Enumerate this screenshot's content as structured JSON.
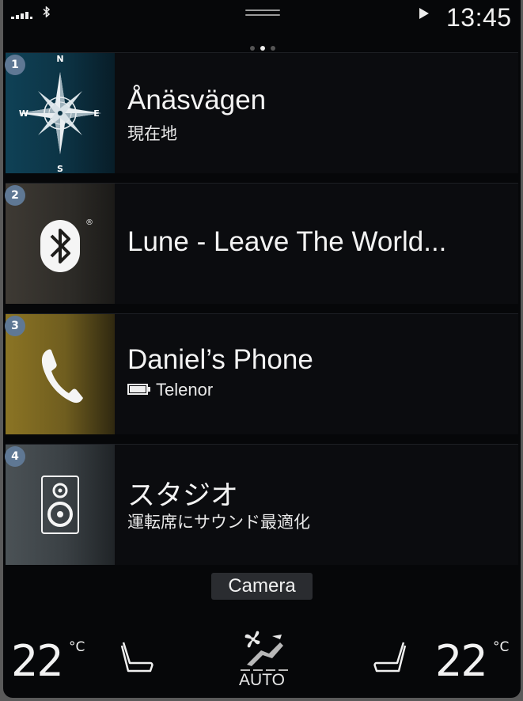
{
  "status": {
    "time": "13:45",
    "signal_icon": "signal-icon",
    "bluetooth_icon": "bluetooth-icon",
    "playing_icon": "play-icon"
  },
  "pager": {
    "pages": 3,
    "current": 2
  },
  "tiles": [
    {
      "number": "1",
      "title": "Ånäsvägen",
      "subtitle": "現在地",
      "icon": "compass-icon",
      "compass": {
        "n": "N",
        "e": "E",
        "s": "S",
        "w": "W"
      }
    },
    {
      "number": "2",
      "title": "Lune - Leave The World...",
      "icon": "bluetooth-icon",
      "registered": "®"
    },
    {
      "number": "3",
      "title": "Daniel’s Phone",
      "subtitle": "Telenor",
      "icon": "phone-icon",
      "battery_icon": "battery-icon"
    },
    {
      "number": "4",
      "title": "スタジオ",
      "subtitle": "運転席にサウンド最適化",
      "icon": "speaker-icon"
    }
  ],
  "camera_button": "Camera",
  "climate": {
    "left_temp": "22",
    "right_temp": "22",
    "unit": "°C",
    "auto_label": "AUTO",
    "left_seat_icon": "seat-heat-left-icon",
    "right_seat_icon": "seat-heat-right-icon",
    "fan_icon": "fan-auto-icon"
  },
  "colors": {
    "badge": "#5f7894",
    "navigation": "#0f4156",
    "media": "#3e3a34",
    "phone": "#8b7424",
    "audio": "#4b5256"
  }
}
